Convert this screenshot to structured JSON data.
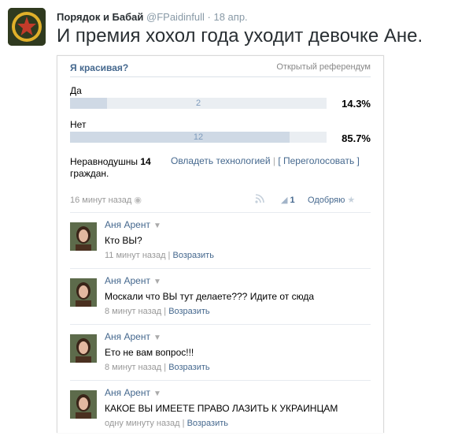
{
  "tweet": {
    "name": "Порядок и Бабай",
    "handle": "@FPaidinfull",
    "date": "· 18 апр.",
    "text": "И премия хохол года уходит девочке Ане."
  },
  "poll": {
    "title": "Я красивая?",
    "type": "Открытый референдум",
    "options": [
      {
        "label": "Да",
        "count": "2",
        "percent": "14.3%",
        "fraction": 0.143
      },
      {
        "label": "Нет",
        "count": "12",
        "percent": "85.7%",
        "fraction": 0.857
      }
    ],
    "stats_prefix": "Неравнодушны ",
    "stats_num": "14",
    "stats_suffix": "граждан.",
    "action_master": "Овладеть технологией",
    "action_sep": " | ",
    "action_revote": "[ Переголосовать ]"
  },
  "post_meta": {
    "time": "16 минут назад",
    "share_count": "1",
    "like_label": "Одобряю"
  },
  "comments": [
    {
      "author": "Аня Арент",
      "text": "Кто ВЫ?",
      "time": "11 минут назад",
      "reply": "Возразить"
    },
    {
      "author": "Аня Арент",
      "text": "Москали что ВЫ тут делаете??? Идите от сюда",
      "time": "8 минут назад",
      "reply": "Возразить"
    },
    {
      "author": "Аня Арент",
      "text": "Ето не вам вопрос!!!",
      "time": "8 минут назад",
      "reply": "Возразить"
    },
    {
      "author": "Аня Арент",
      "text": "КАКОЕ ВЫ ИМЕЕТЕ ПРАВО ЛАЗИТЬ К УКРАИНЦАМ",
      "time": "одну минуту назад",
      "reply": "Возразить"
    }
  ],
  "colors": {
    "link": "#45688e",
    "bar_fill": "#cfd9e5",
    "bar_track": "#eaeef2"
  }
}
